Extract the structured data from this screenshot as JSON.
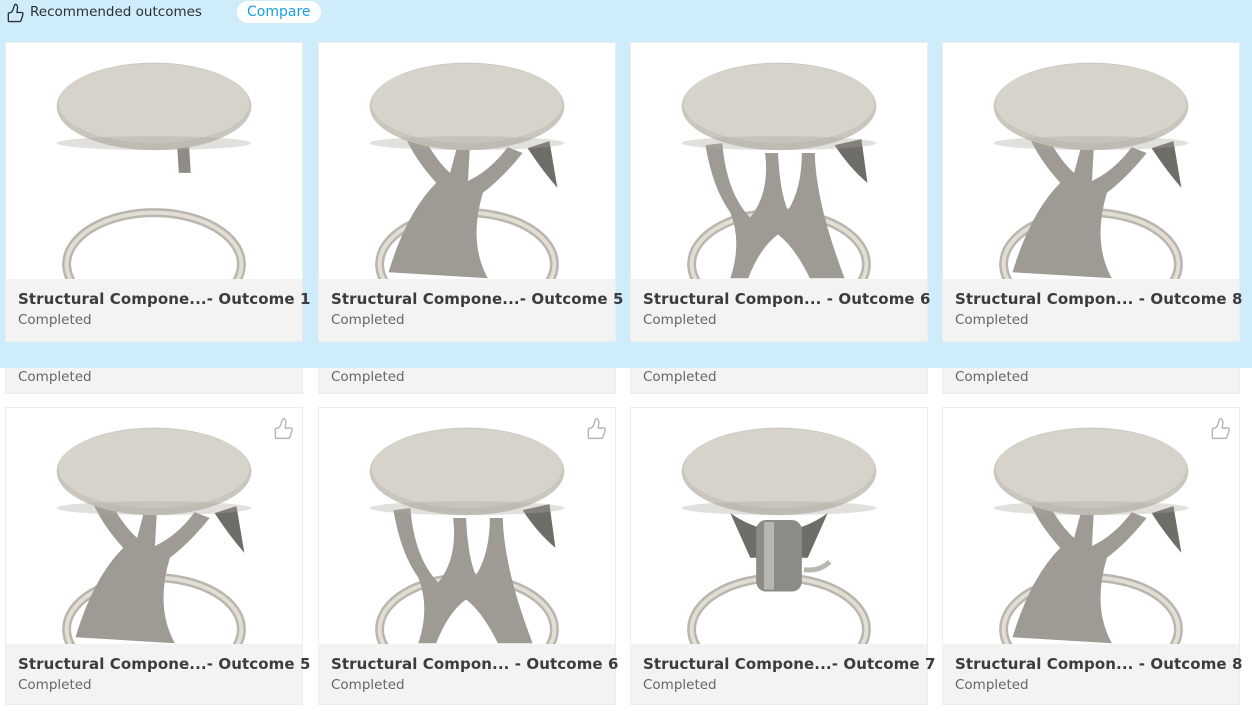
{
  "recommended": {
    "header_title": "Recommended outcomes",
    "compare_label": "Compare",
    "header_icon": "thumbs-up-outline-icon",
    "cards": [
      {
        "title": "Structural Compone...- Outcome 1",
        "status": "Completed",
        "shape": "post"
      },
      {
        "title": "Structural Compone...- Outcome 5",
        "status": "Completed",
        "shape": "organic"
      },
      {
        "title": "Structural Compon...  - Outcome 6",
        "status": "Completed",
        "shape": "branch"
      },
      {
        "title": "Structural Compon...  - Outcome 8",
        "status": "Completed",
        "shape": "organic"
      }
    ]
  },
  "grid": {
    "peek_row": [
      {
        "status": "Completed"
      },
      {
        "status": "Completed"
      },
      {
        "status": "Completed"
      },
      {
        "status": "Completed"
      }
    ],
    "cards": [
      {
        "title": "Structural Compone...- Outcome 5",
        "status": "Completed",
        "shape": "organic",
        "like_icon": true
      },
      {
        "title": "Structural Compon...  - Outcome 6",
        "status": "Completed",
        "shape": "branch",
        "like_icon": true
      },
      {
        "title": "Structural Compone...- Outcome 7",
        "status": "Completed",
        "shape": "cylinder",
        "like_icon": false
      },
      {
        "title": "Structural Compon...  - Outcome 8",
        "status": "Completed",
        "shape": "organic",
        "like_icon": true
      }
    ]
  },
  "colors": {
    "panel_bg": "#cfecfb",
    "card_bg": "#f3f3f3",
    "accent": "#1a9fe0",
    "model_fill": "#c9c6bd"
  }
}
